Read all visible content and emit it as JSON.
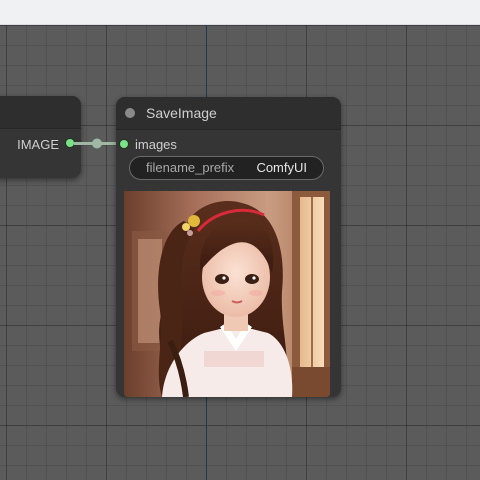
{
  "left_node": {
    "output_label": "IMAGE"
  },
  "save_node": {
    "title": "SaveImage",
    "input_label": "images",
    "widget": {
      "name": "filename_prefix",
      "value": "ComfyUI"
    },
    "preview": {
      "icon": "portrait-image",
      "description_visible": false
    }
  },
  "colors": {
    "canvas": "#5b5b5b",
    "node_body": "#353535",
    "node_title": "#2e2e2e",
    "slot_active": "#7ae387",
    "link": "#9fb8a3"
  }
}
